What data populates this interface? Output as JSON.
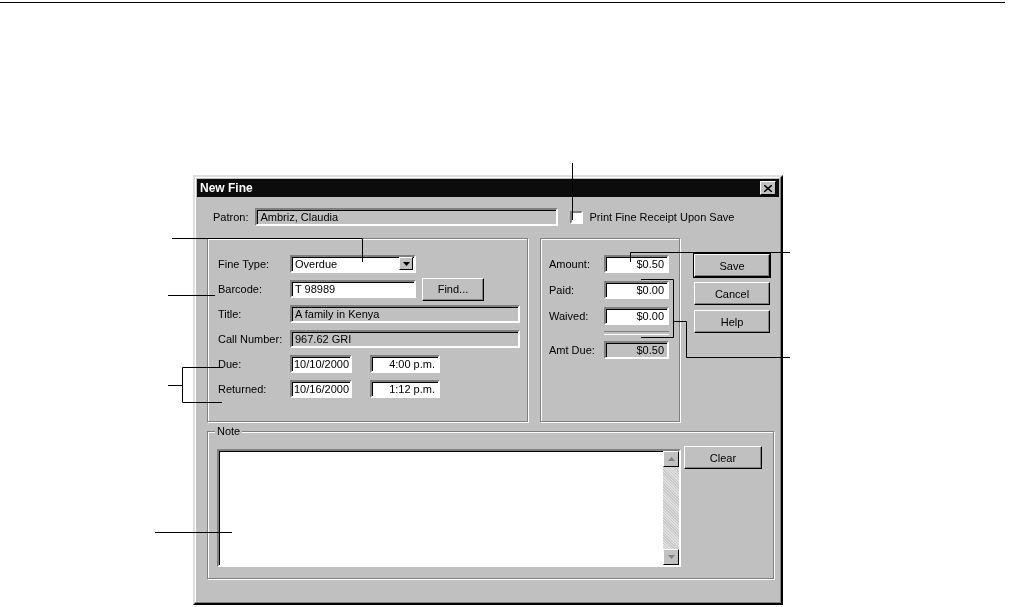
{
  "window": {
    "title": "New Fine"
  },
  "patron": {
    "label": "Patron:",
    "value": "Ambriz, Claudia"
  },
  "print_receipt": {
    "label": "Print Fine Receipt Upon Save",
    "checked": false
  },
  "item_fields": [
    {
      "kind": "dropdown",
      "label": "Fine Type:",
      "value": "Overdue"
    },
    {
      "kind": "input",
      "label": "Barcode:",
      "value": "T 98989",
      "button": "Find..."
    },
    {
      "kind": "readonly",
      "label": "Title:",
      "value": "A family in Kenya"
    },
    {
      "kind": "readonly",
      "label": "Call Number:",
      "value": "967.62 GRI"
    },
    {
      "kind": "datetime",
      "label": "Due:",
      "date": "10/10/2000",
      "time": "4:00 p.m."
    },
    {
      "kind": "datetime",
      "label": "Returned:",
      "date": "10/16/2000",
      "time": "1:12 p.m."
    }
  ],
  "amounts": [
    {
      "kind": "input",
      "label": "Amount:",
      "value": "$0.50"
    },
    {
      "kind": "input",
      "label": "Paid:",
      "value": "$0.00"
    },
    {
      "kind": "input",
      "label": "Waived:",
      "value": "$0.00"
    },
    {
      "kind": "total",
      "label": "Amt Due:",
      "value": "$0.50"
    }
  ],
  "buttons": [
    {
      "label": "Save",
      "default": true
    },
    {
      "label": "Cancel",
      "default": false
    },
    {
      "label": "Help",
      "default": false
    }
  ],
  "note": {
    "label": "Note",
    "button": "Clear"
  }
}
